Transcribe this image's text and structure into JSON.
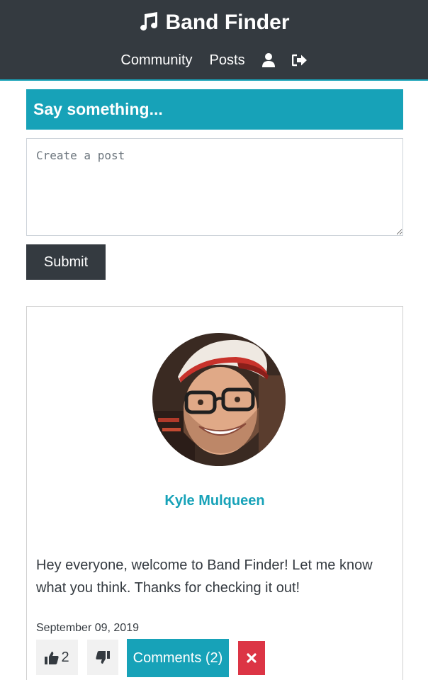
{
  "nav": {
    "brand": "Band Finder",
    "brand_icon": "music-note-icon",
    "links": [
      "Community",
      "Posts"
    ],
    "profile_icon": "user-icon",
    "logout_icon": "sign-out-icon"
  },
  "composer": {
    "heading": "Say something...",
    "placeholder": "Create a post",
    "value": "",
    "submit_label": "Submit"
  },
  "post": {
    "author": "Kyle Mulqueen",
    "avatar": "profile-photo",
    "body": "Hey everyone, welcome to Band Finder! Let me know what you think. Thanks for checking it out!",
    "date": "September 09, 2019",
    "likes": "2",
    "comments_label": "Comments (2)"
  },
  "colors": {
    "navbar": "#343a40",
    "accent": "#17a2b8",
    "danger": "#dc3545",
    "button_light": "#f1f1f1"
  }
}
